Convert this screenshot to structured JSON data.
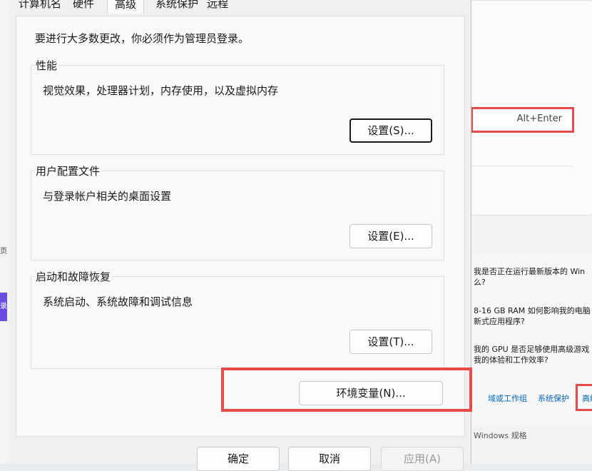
{
  "dialog": {
    "tabs": [
      {
        "label": "计算机名"
      },
      {
        "label": "硬件"
      },
      {
        "label": "高级",
        "active": true
      },
      {
        "label": "系统保护"
      },
      {
        "label": "远程"
      }
    ],
    "admin_note": "要进行大多数更改，你必须作为管理员登录。",
    "groups": {
      "performance": {
        "title": "性能",
        "description": "视觉效果，处理器计划，内存使用，以及虚拟内存",
        "button": "设置(S)..."
      },
      "user_profiles": {
        "title": "用户配置文件",
        "description": "与登录帐户相关的桌面设置",
        "button": "设置(E)..."
      },
      "startup_recovery": {
        "title": "启动和故障恢复",
        "description": "系统启动、系统故障和调试信息",
        "button": "设置(T)..."
      }
    },
    "env_button": "环境变量(N)...",
    "footer": {
      "ok": "确定",
      "cancel": "取消",
      "apply": "应用(A)"
    }
  },
  "background": {
    "shortcut": "Alt+Enter",
    "faq": [
      "我是否正在运行最新版本的 Win\n么?",
      "8-16 GB RAM 如何影响我的电脑\n新式应用程序?",
      "我的 GPU 是否足够使用高级游戏\n我的体验和工作效率?"
    ],
    "links": [
      "域或工作组",
      "系统保护",
      "高级"
    ],
    "bottom_text": "Windows 规格",
    "left_glyph": "页",
    "left_badge": "录"
  },
  "colors": {
    "highlight": "#e84a4a",
    "link": "#0067c0",
    "dialog_bg": "#f0f0f0",
    "panel_bg": "#f9f9f9"
  }
}
